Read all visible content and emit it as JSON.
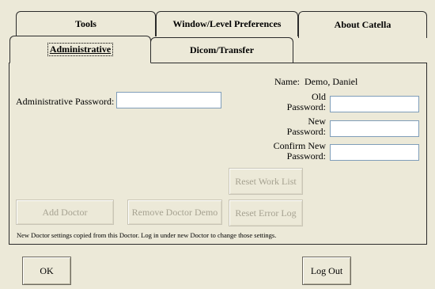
{
  "tabs_back": [
    {
      "label": "Tools"
    },
    {
      "label": "Window/Level Preferences"
    },
    {
      "label": "About Catella"
    }
  ],
  "tabs_front": [
    {
      "label": "Administrative"
    },
    {
      "label": "Dicom/Transfer"
    }
  ],
  "admin": {
    "name_label": "Name:",
    "name_value": "Demo, Daniel",
    "admin_password_label": "Administrative Password:",
    "admin_password_value": "",
    "old_password_label_1": "Old",
    "old_password_label_2": "Password:",
    "old_password_value": "",
    "new_password_label_1": "New",
    "new_password_label_2": "Password:",
    "new_password_value": "",
    "confirm_password_label_1": "Confirm New",
    "confirm_password_label_2": "Password:",
    "confirm_password_value": "",
    "reset_work_list": "Reset Work List",
    "add_doctor": "Add Doctor",
    "remove_doctor_demo": "Remove Doctor Demo",
    "reset_error_log": "Reset Error Log",
    "note": "New Doctor settings copied from this Doctor.  Log in under new Doctor to change those settings."
  },
  "footer": {
    "ok": "OK",
    "log_out": "Log Out"
  }
}
